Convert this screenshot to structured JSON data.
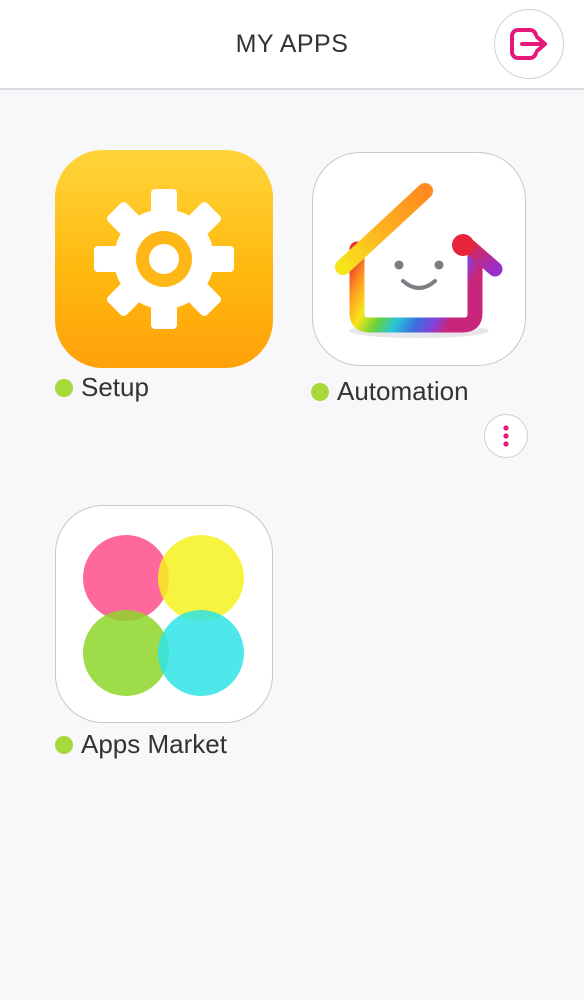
{
  "header": {
    "title": "MY APPS",
    "logout_icon": "logout-icon",
    "accent_color": "#e6197a"
  },
  "apps": [
    {
      "label": "Setup",
      "icon": "gear-icon",
      "status_color": "#a6d93a"
    },
    {
      "label": "Automation",
      "icon": "rainbow-house-icon",
      "status_color": "#a6d93a"
    },
    {
      "label": "Apps Market",
      "icon": "four-circles-icon",
      "status_color": "#a6d93a"
    }
  ],
  "more_icon": "more-vertical-icon"
}
